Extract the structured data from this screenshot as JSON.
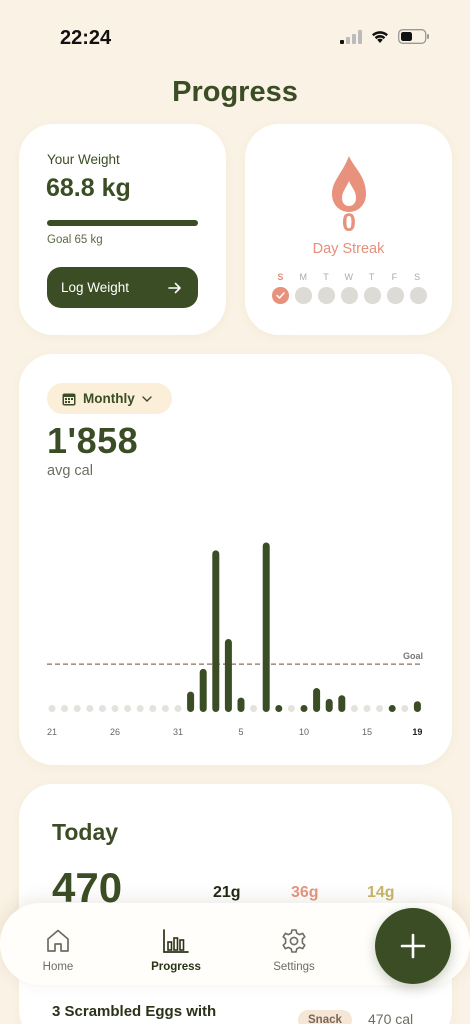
{
  "status_bar": {
    "time": "22:24"
  },
  "page": {
    "title": "Progress"
  },
  "weight_card": {
    "label": "Your Weight",
    "value": "68.8 kg",
    "goal": "Goal 65 kg",
    "progress_fraction": 1.0,
    "log_button": "Log Weight"
  },
  "streak_card": {
    "count": "0",
    "label": "Day Streak",
    "days": [
      "S",
      "M",
      "T",
      "W",
      "T",
      "F",
      "S"
    ],
    "completed": [
      true,
      false,
      false,
      false,
      false,
      false,
      false
    ]
  },
  "calorie_card": {
    "period": "Monthly",
    "avg_value": "1'858",
    "avg_label": "avg cal",
    "goal_label": "Goal"
  },
  "chart_data": {
    "type": "bar",
    "x": [
      21,
      22,
      23,
      24,
      25,
      26,
      27,
      28,
      29,
      30,
      31,
      1,
      2,
      3,
      4,
      5,
      6,
      7,
      8,
      9,
      10,
      11,
      12,
      13,
      14,
      15,
      16,
      17,
      18,
      19
    ],
    "tick_labels": [
      "21",
      "26",
      "31",
      "5",
      "10",
      "15",
      "19"
    ],
    "tick_indices": [
      0,
      5,
      10,
      15,
      20,
      25,
      29
    ],
    "highlight_tick": "19",
    "values": [
      0,
      0,
      0,
      0,
      0,
      0,
      0,
      0,
      0,
      0,
      0,
      850,
      1800,
      6750,
      3050,
      600,
      0,
      7080,
      250,
      0,
      250,
      1000,
      550,
      700,
      0,
      0,
      0,
      250,
      0,
      450
    ],
    "goal": 2000,
    "ylim": [
      0,
      7600
    ],
    "colors": {
      "bar": "#3b4d24",
      "empty_dot": "#e4e2dc",
      "goal_line": "#8a6e60"
    }
  },
  "today_card": {
    "title": "Today",
    "calories": "470",
    "protein": "21g",
    "carbs": "36g",
    "fat": "14g"
  },
  "meal": {
    "name": "3 Scrambled Eggs with",
    "tag": "Snack",
    "calories": "470 cal"
  },
  "nav": {
    "items": [
      {
        "label": "Home",
        "icon": "home-icon"
      },
      {
        "label": "Progress",
        "icon": "bar-chart-icon"
      },
      {
        "label": "Settings",
        "icon": "gear-icon"
      }
    ],
    "active": "Progress",
    "fab_icon": "plus-icon"
  }
}
